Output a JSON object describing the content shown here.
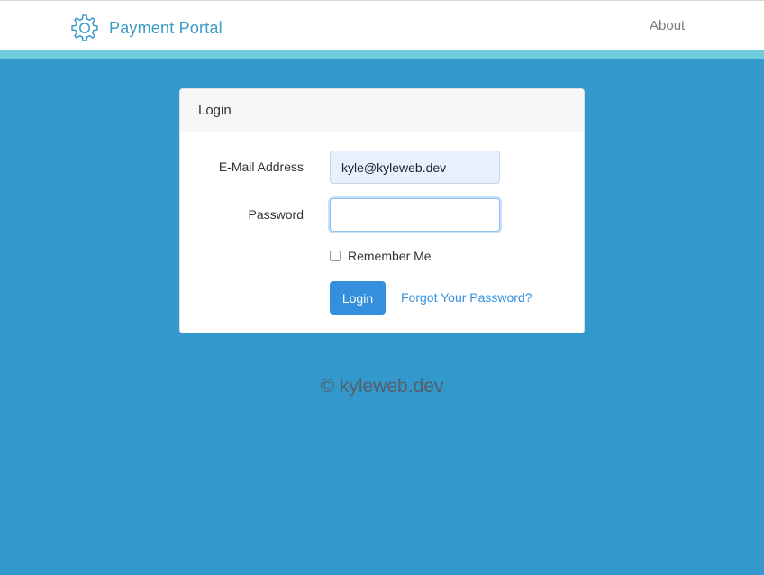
{
  "navbar": {
    "brand_icon": "gear-icon",
    "brand_name": "Payment Portal",
    "about_label": "About"
  },
  "login_card": {
    "title": "Login",
    "email_label": "E-Mail Address",
    "email_value": "kyle@kyleweb.dev",
    "password_label": "Password",
    "password_value": "",
    "remember_label": "Remember Me",
    "remember_checked": false,
    "login_button": "Login",
    "forgot_link": "Forgot Your Password?"
  },
  "footer": {
    "copyright": "© kyleweb.dev"
  },
  "colors": {
    "background": "#3398cc",
    "accent_stripe": "#6dcbdc",
    "brand": "#3a9ac9",
    "primary_button": "#3490dc"
  }
}
